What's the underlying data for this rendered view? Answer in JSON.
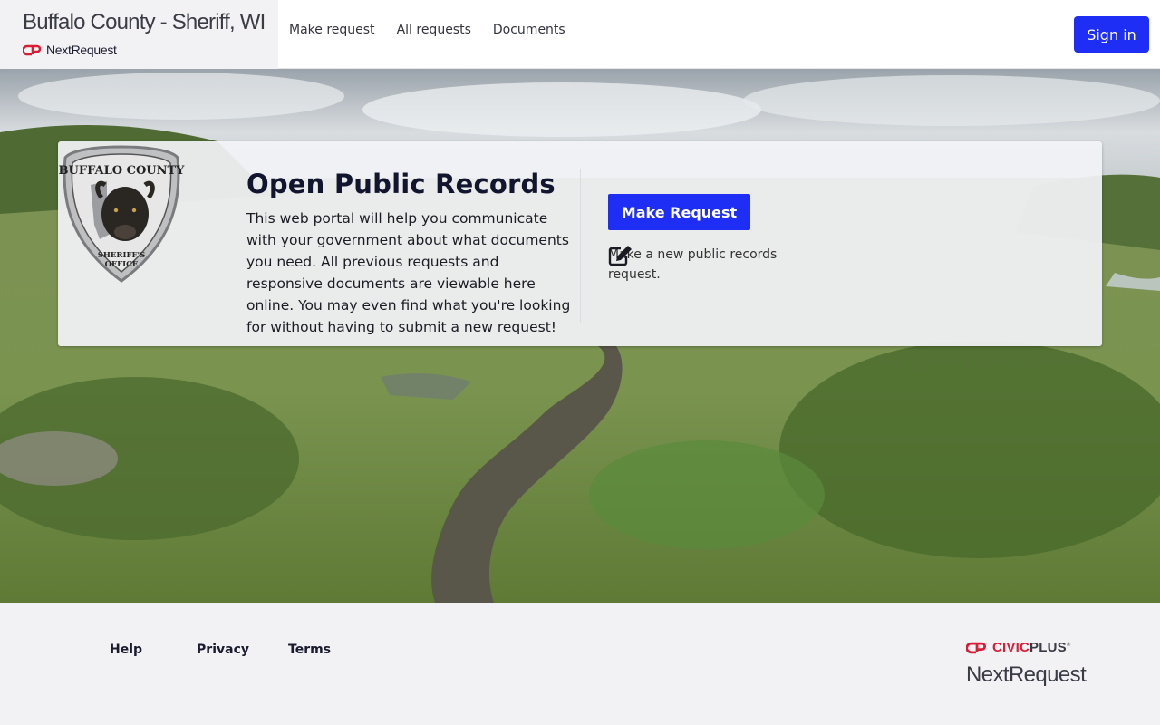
{
  "header": {
    "agency_title": "Buffalo County - Sheriff, WI",
    "product_name": "NextRequest",
    "nav": [
      "Make request",
      "All requests",
      "Documents"
    ],
    "sign_in_label": "Sign in"
  },
  "hero": {
    "title": "Open Public Records",
    "description": "This web portal will help you communicate with your government about what documents you need. All previous requests and responsive documents are viewable here online. You may even find what you're looking for without having to submit a new request!",
    "make_request_label": "Make Request",
    "make_request_hint": "Make a new public records request.",
    "seal": {
      "top_text": "BUFFALO COUNTY",
      "bottom_text_1": "SHERIFF'S",
      "bottom_text_2": "OFFICE"
    }
  },
  "footer": {
    "links": [
      "Help",
      "Privacy",
      "Terms"
    ],
    "brand_civic": "CIVIC",
    "brand_plus": "PLUS",
    "brand_product": "NextRequest"
  },
  "colors": {
    "primary_button": "#1f2ef5",
    "civicplus_red": "#d81e36",
    "footer_bg": "#f2f2f4"
  },
  "icons": [
    "civicplus-logo-icon",
    "edit-icon",
    "sheriff-seal"
  ]
}
